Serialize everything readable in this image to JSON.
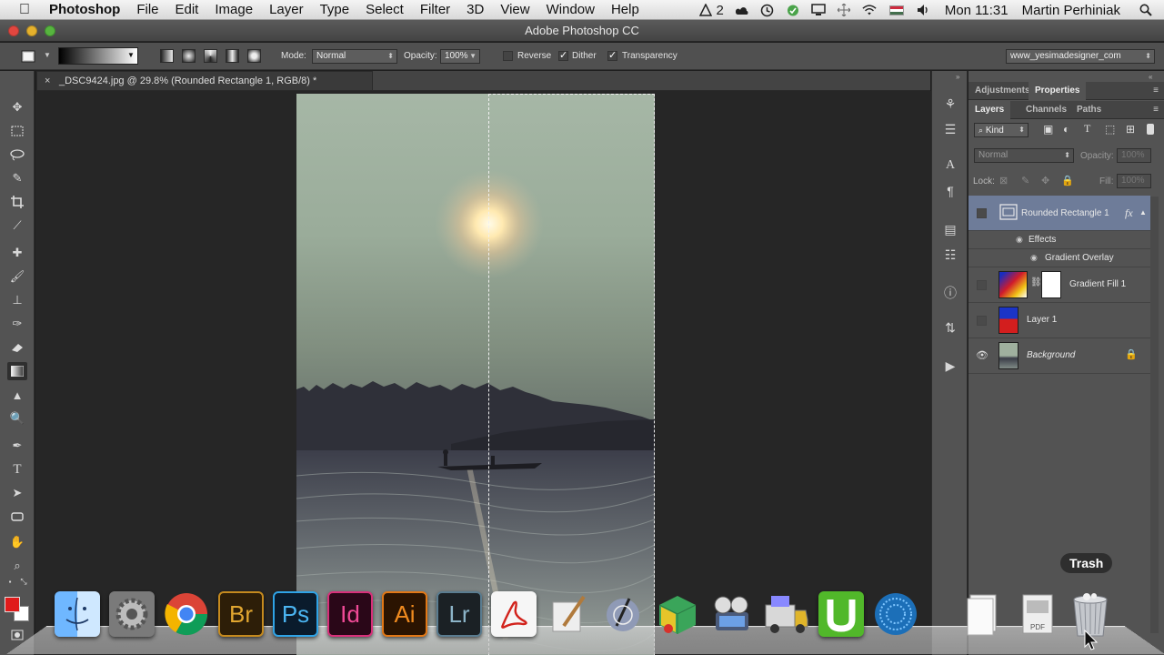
{
  "menubar": {
    "app_name": "Photoshop",
    "items": [
      "File",
      "Edit",
      "Image",
      "Layer",
      "Type",
      "Select",
      "Filter",
      "3D",
      "View",
      "Window",
      "Help"
    ],
    "notification_count": "2",
    "clock": "Mon 11:31",
    "user": "Martin Perhiniak"
  },
  "window": {
    "title": "Adobe Photoshop CC"
  },
  "options_bar": {
    "mode_label": "Mode:",
    "mode_value": "Normal",
    "opacity_label": "Opacity:",
    "opacity_value": "100%",
    "reverse_label": "Reverse",
    "dither_label": "Dither",
    "transparency_label": "Transparency",
    "reverse_checked": false,
    "dither_checked": true,
    "transparency_checked": true,
    "workspace": "www_yesimadesigner_com"
  },
  "document": {
    "tab_title": "_DSC9424.jpg @ 29.8% (Rounded Rectangle 1, RGB/8) *"
  },
  "panels": {
    "top_tabs": [
      "Adjustments",
      "Properties"
    ],
    "layer_tabs": [
      "Layers",
      "Channels",
      "Paths"
    ],
    "kind_filter": "Kind",
    "blend_mode": "Normal",
    "opacity_label": "Opacity:",
    "opacity_value": "100%",
    "lock_label": "Lock:",
    "fill_label": "Fill:",
    "fill_value": "100%"
  },
  "layers": [
    {
      "name": "Rounded Rectangle 1",
      "selected": true,
      "visible": false,
      "fx": "fx"
    },
    {
      "name": "Effects",
      "type": "effects"
    },
    {
      "name": "Gradient Overlay",
      "type": "effect"
    },
    {
      "name": "Gradient Fill 1",
      "visible": false
    },
    {
      "name": "Layer 1",
      "visible": false
    },
    {
      "name": "Background",
      "visible": true,
      "locked": true
    }
  ],
  "dock": {
    "items": [
      "Finder",
      "System Preferences",
      "Google Chrome",
      "Bridge",
      "Photoshop",
      "InDesign",
      "Illustrator",
      "Lightroom",
      "Acrobat",
      "Script Editor",
      "Image Capture",
      "Flash",
      "iMovie",
      "Transmit",
      "Ultra",
      "Sound",
      "Documents",
      "PDF",
      "Trash"
    ],
    "bridge_label": "Br",
    "ps_label": "Ps",
    "id_label": "Id",
    "ai_label": "Ai",
    "lr_label": "Lr",
    "trash_tooltip": "Trash"
  }
}
